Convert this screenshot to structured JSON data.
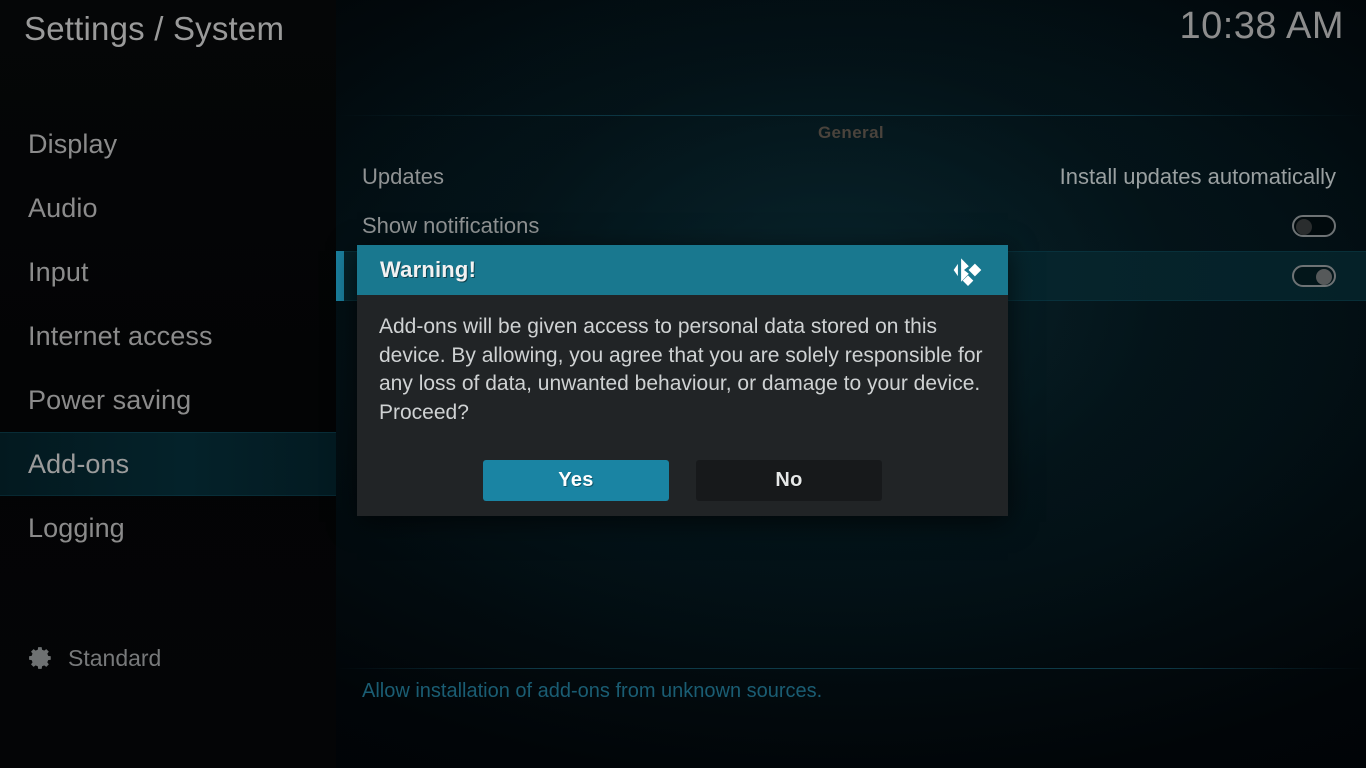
{
  "header": {
    "title": "Settings / System",
    "clock": "10:38 AM"
  },
  "sidebar": {
    "items": [
      {
        "label": "Display",
        "selected": false
      },
      {
        "label": "Audio",
        "selected": false
      },
      {
        "label": "Input",
        "selected": false
      },
      {
        "label": "Internet access",
        "selected": false
      },
      {
        "label": "Power saving",
        "selected": false
      },
      {
        "label": "Add-ons",
        "selected": true
      },
      {
        "label": "Logging",
        "selected": false
      }
    ],
    "profile": {
      "icon": "gear-icon",
      "label": "Standard"
    }
  },
  "content": {
    "group_title": "General",
    "rows": [
      {
        "label": "Updates",
        "value": "Install updates automatically",
        "control": "text",
        "highlighted": false
      },
      {
        "label": "Show notifications",
        "value": "",
        "control": "toggle",
        "toggle_state": "off",
        "highlighted": false
      },
      {
        "label": "",
        "value": "",
        "control": "toggle",
        "toggle_state": "on",
        "highlighted": true
      }
    ]
  },
  "footer": {
    "help_text": "Allow installation of add-ons from unknown sources."
  },
  "dialog": {
    "title": "Warning!",
    "logo": "kodi-logo",
    "message": "Add-ons will be given access to personal data stored on this device. By allowing, you agree that you are solely responsible for any loss of data, unwanted behaviour, or damage to your device. Proceed?",
    "confirm_label": "Yes",
    "cancel_label": "No",
    "focused_button": "Yes"
  },
  "colors": {
    "accent": "#19788f",
    "accent_button": "#1a84a3",
    "highlight_row": "#06262e",
    "footer_text": "#1a5d73",
    "dialog_bg": "#212426"
  }
}
